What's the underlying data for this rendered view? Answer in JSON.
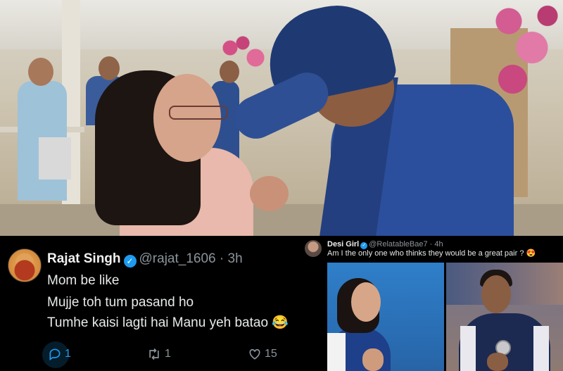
{
  "tweet": {
    "display_name": "Rajat Singh",
    "handle": "@rajat_1606",
    "separator": "·",
    "time": "3h",
    "lines": [
      "Mom be like",
      "Mujje toh tum pasand ho",
      "Tumhe kaisi lagti hai Manu yeh batao 😂"
    ],
    "reply_count": "1",
    "retweet_count": "1",
    "like_count": "15"
  },
  "quoted_tweet": {
    "display_name": "Desi Girl",
    "handle": "@RelatableBae7",
    "separator": "·",
    "time": "4h",
    "text": "Am I the only one who thinks they would be a great pair ? 😍"
  },
  "colors": {
    "verified_badge": "#1d9bf0",
    "muted_text": "#8b949b",
    "background": "#000000"
  },
  "icons": [
    "verified-badge-icon",
    "reply-icon",
    "retweet-icon",
    "like-icon"
  ]
}
